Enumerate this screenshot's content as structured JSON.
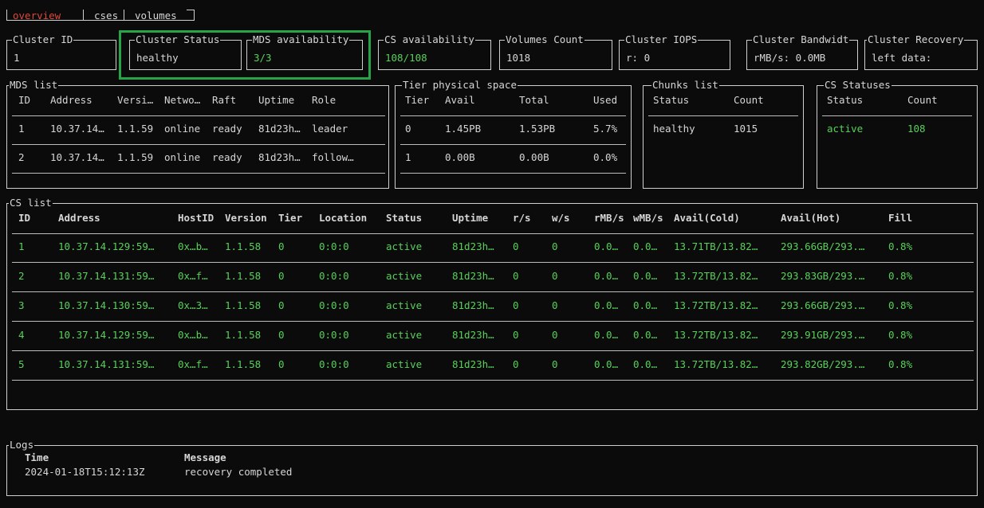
{
  "tabs": [
    {
      "label": "overview",
      "active": true
    },
    {
      "label": "cses",
      "active": false
    },
    {
      "label": "volumes",
      "active": false
    }
  ],
  "stats": {
    "cluster_id": {
      "title": "Cluster ID",
      "value": "1"
    },
    "cluster_status": {
      "title": "Cluster Status",
      "value": "healthy"
    },
    "mds_availability": {
      "title": "MDS availability",
      "value": "3/3"
    },
    "cs_availability": {
      "title": "CS availability",
      "value": "108/108"
    },
    "volumes_count": {
      "title": "Volumes Count",
      "value": "1018"
    },
    "cluster_iops": {
      "title": "Cluster IOPS",
      "value": "r: 0"
    },
    "cluster_bandwidth": {
      "title": "Cluster Bandwidt",
      "value": "rMB/s: 0.0MB"
    },
    "cluster_recovery": {
      "title": "Cluster Recovery",
      "value": "left data:"
    }
  },
  "mds_list": {
    "title": "MDS list",
    "headers": [
      "ID",
      "Address",
      "Versi…",
      "Netwo…",
      "Raft",
      "Uptime",
      "Role"
    ],
    "rows": [
      [
        "1",
        "10.37.14…",
        "1.1.59",
        "online",
        "ready",
        "81d23h…",
        "leader"
      ],
      [
        "2",
        "10.37.14…",
        "1.1.59",
        "online",
        "ready",
        "81d23h…",
        "follow…"
      ]
    ]
  },
  "tier_space": {
    "title": "Tier physical space",
    "headers": [
      "Tier",
      "Avail",
      "Total",
      "Used"
    ],
    "rows": [
      [
        "0",
        "1.45PB",
        "1.53PB",
        "5.7%"
      ],
      [
        "1",
        "0.00B",
        "0.00B",
        "0.0%"
      ]
    ]
  },
  "chunks_list": {
    "title": "Chunks list",
    "headers": [
      "Status",
      "Count"
    ],
    "rows": [
      [
        "healthy",
        "1015"
      ]
    ]
  },
  "cs_statuses": {
    "title": "CS Statuses",
    "headers": [
      "Status",
      "Count"
    ],
    "rows": [
      [
        "active",
        "108"
      ]
    ]
  },
  "cs_list": {
    "title": "CS list",
    "headers": [
      "ID",
      "Address",
      "HostID",
      "Version",
      "Tier",
      "Location",
      "Status",
      "Uptime",
      "r/s",
      "w/s",
      "rMB/s",
      "wMB/s",
      "Avail(Cold)",
      "Avail(Hot)",
      "Fill"
    ],
    "rows": [
      [
        "1",
        "10.37.14.129:59…",
        "0x…b…",
        "1.1.58",
        "0",
        "0:0:0",
        "active",
        "81d23h…",
        "0",
        "0",
        "0.0…",
        "0.0…",
        "13.71TB/13.82…",
        "293.66GB/293.…",
        "0.8%"
      ],
      [
        "2",
        "10.37.14.131:59…",
        "0x…f…",
        "1.1.58",
        "0",
        "0:0:0",
        "active",
        "81d23h…",
        "0",
        "0",
        "0.0…",
        "0.0…",
        "13.72TB/13.82…",
        "293.83GB/293.…",
        "0.8%"
      ],
      [
        "3",
        "10.37.14.130:59…",
        "0x…3…",
        "1.1.58",
        "0",
        "0:0:0",
        "active",
        "81d23h…",
        "0",
        "0",
        "0.0…",
        "0.0…",
        "13.72TB/13.82…",
        "293.66GB/293.…",
        "0.8%"
      ],
      [
        "4",
        "10.37.14.129:59…",
        "0x…b…",
        "1.1.58",
        "0",
        "0:0:0",
        "active",
        "81d23h…",
        "0",
        "0",
        "0.0…",
        "0.0…",
        "13.72TB/13.82…",
        "293.91GB/293.…",
        "0.8%"
      ],
      [
        "5",
        "10.37.14.131:59…",
        "0x…f…",
        "1.1.58",
        "0",
        "0:0:0",
        "active",
        "81d23h…",
        "0",
        "0",
        "0.0…",
        "0.0…",
        "13.72TB/13.82…",
        "293.82GB/293.…",
        "0.8%"
      ]
    ]
  },
  "logs": {
    "title": "Logs",
    "headers": [
      "Time",
      "Message"
    ],
    "rows": [
      [
        "2024-01-18T15:12:13Z",
        "recovery completed"
      ]
    ]
  },
  "colors": {
    "accent_green": "#58d05a",
    "active_tab": "#e0463a",
    "highlight": "#27a34a"
  }
}
